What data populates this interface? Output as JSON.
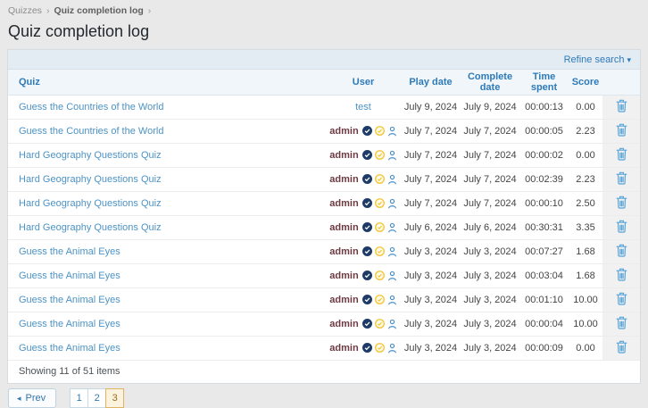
{
  "breadcrumb": {
    "root": "Quizzes",
    "separator": "›",
    "current": "Quiz completion log"
  },
  "page": {
    "title": "Quiz completion log"
  },
  "toolbar": {
    "refine_search_label": "Refine search"
  },
  "icons": {
    "caret_down": "▾",
    "prev_arrow": "◂"
  },
  "table": {
    "columns": [
      "Quiz",
      "User",
      "Play date",
      "Complete date",
      "Time spent",
      "Score"
    ],
    "rows": [
      {
        "quiz": "Guess the Countries of the World",
        "user": "test",
        "user_badges": false,
        "play_date": "July 9, 2024",
        "complete_date": "July 9, 2024",
        "time_spent": "00:00:13",
        "score": "0.00"
      },
      {
        "quiz": "Guess the Countries of the World",
        "user": "admin",
        "user_badges": true,
        "play_date": "July 7, 2024",
        "complete_date": "July 7, 2024",
        "time_spent": "00:00:05",
        "score": "2.23"
      },
      {
        "quiz": "Hard Geography Questions Quiz",
        "user": "admin",
        "user_badges": true,
        "play_date": "July 7, 2024",
        "complete_date": "July 7, 2024",
        "time_spent": "00:00:02",
        "score": "0.00"
      },
      {
        "quiz": "Hard Geography Questions Quiz",
        "user": "admin",
        "user_badges": true,
        "play_date": "July 7, 2024",
        "complete_date": "July 7, 2024",
        "time_spent": "00:02:39",
        "score": "2.23"
      },
      {
        "quiz": "Hard Geography Questions Quiz",
        "user": "admin",
        "user_badges": true,
        "play_date": "July 7, 2024",
        "complete_date": "July 7, 2024",
        "time_spent": "00:00:10",
        "score": "2.50"
      },
      {
        "quiz": "Hard Geography Questions Quiz",
        "user": "admin",
        "user_badges": true,
        "play_date": "July 6, 2024",
        "complete_date": "July 6, 2024",
        "time_spent": "00:30:31",
        "score": "3.35"
      },
      {
        "quiz": "Guess the Animal Eyes",
        "user": "admin",
        "user_badges": true,
        "play_date": "July 3, 2024",
        "complete_date": "July 3, 2024",
        "time_spent": "00:07:27",
        "score": "1.68"
      },
      {
        "quiz": "Guess the Animal Eyes",
        "user": "admin",
        "user_badges": true,
        "play_date": "July 3, 2024",
        "complete_date": "July 3, 2024",
        "time_spent": "00:03:04",
        "score": "1.68"
      },
      {
        "quiz": "Guess the Animal Eyes",
        "user": "admin",
        "user_badges": true,
        "play_date": "July 3, 2024",
        "complete_date": "July 3, 2024",
        "time_spent": "00:01:10",
        "score": "10.00"
      },
      {
        "quiz": "Guess the Animal Eyes",
        "user": "admin",
        "user_badges": true,
        "play_date": "July 3, 2024",
        "complete_date": "July 3, 2024",
        "time_spent": "00:00:04",
        "score": "10.00"
      },
      {
        "quiz": "Guess the Animal Eyes",
        "user": "admin",
        "user_badges": true,
        "play_date": "July 3, 2024",
        "complete_date": "July 3, 2024",
        "time_spent": "00:00:09",
        "score": "0.00"
      }
    ],
    "summary": "Showing 11 of 51 items"
  },
  "pagination": {
    "prev_label": "Prev",
    "pages": [
      "1",
      "2",
      "3"
    ],
    "current_page": "3"
  },
  "colors": {
    "accent_blue": "#2e7ab8",
    "link_blue": "#4d93c5",
    "admin_name": "#6d3a42",
    "trash_blue": "#58a4d8",
    "topbar_bg": "#e4ecf3",
    "current_page_bg": "#fbf3dd",
    "current_page_border": "#ddb463"
  }
}
